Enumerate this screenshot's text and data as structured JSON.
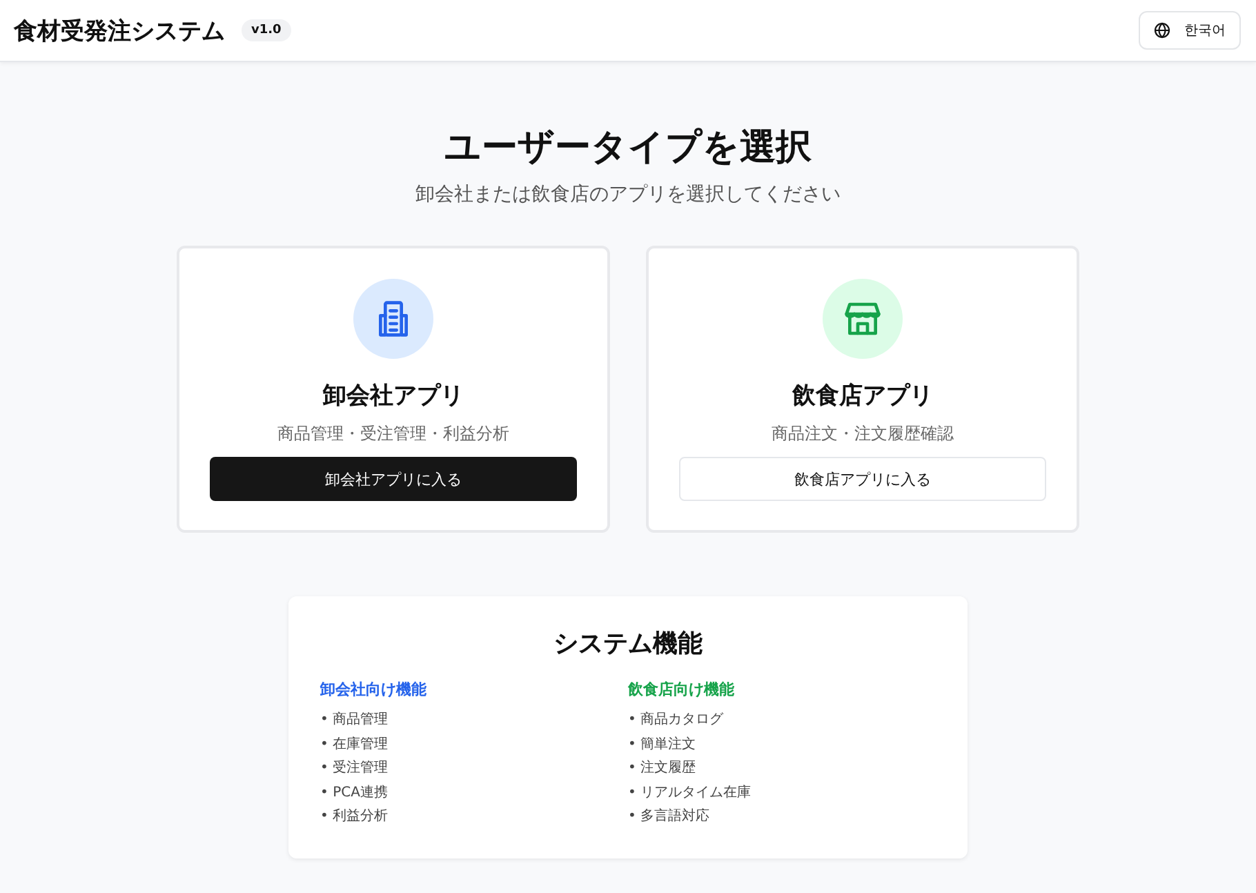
{
  "header": {
    "title": "食材受発注システム",
    "version": "v1.0",
    "language_button": "한국어"
  },
  "heading": "ユーザータイプを選択",
  "subheading": "卸会社または飲食店のアプリを選択してください",
  "apps": [
    {
      "kind": "wholesale",
      "title": "卸会社アプリ",
      "description": "商品管理・受注管理・利益分析",
      "button": {
        "label": "卸会社アプリに入る",
        "kind": "primary"
      }
    },
    {
      "kind": "restaurant",
      "title": "飲食店アプリ",
      "description": "商品注文・注文履歴確認",
      "button": {
        "label": "飲食店アプリに入る",
        "kind": "outline"
      }
    }
  ],
  "features": {
    "title": "システム機能",
    "groups": [
      {
        "title": "卸会社向け機能",
        "color": "#2563eb",
        "items": [
          "• 商品管理",
          "• 在庫管理",
          "• 受注管理",
          "• PCA連携",
          "• 利益分析"
        ]
      },
      {
        "title": "飲食店向け機能",
        "color": "#16a34a",
        "items": [
          "• 商品カタログ",
          "• 簡単注文",
          "• 注文履歴",
          "• リアルタイム在庫",
          "• 多言語対応"
        ]
      }
    ]
  }
}
